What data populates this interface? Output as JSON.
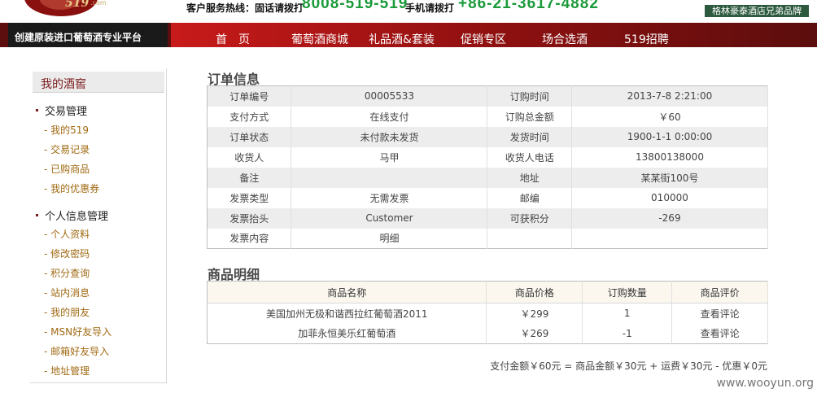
{
  "header": {
    "logo_text": "519",
    "logo_suffix": ".com",
    "service_hotline_label": "客户服务热线：固话请拨打",
    "service_hotline_number": "8008-519-519",
    "mobile_label": "手机请拨打",
    "mobile_number": "+86-21-3617-4882",
    "brand_text": "格林豪泰酒店兄弟品牌",
    "slogan": "创建原装进口葡萄酒专业平台"
  },
  "nav": {
    "items": [
      {
        "label": "首　页"
      },
      {
        "label": "葡萄酒商城"
      },
      {
        "label": "礼品酒&套装"
      },
      {
        "label": "促销专区"
      },
      {
        "label": "场合选酒"
      },
      {
        "label": "519招聘"
      }
    ]
  },
  "sidebar": {
    "title": "我的酒窖",
    "sections": [
      {
        "heading": "交易管理",
        "items": [
          "- 我的519",
          "- 交易记录",
          "- 已购商品",
          "- 我的优惠券"
        ]
      },
      {
        "heading": "个人信息管理",
        "items": [
          "- 个人资料",
          "- 修改密码",
          "- 积分查询",
          "- 站内消息",
          "- 我的朋友",
          "- MSN好友导入",
          "- 邮箱好友导入",
          "- 地址管理"
        ]
      }
    ]
  },
  "order_info": {
    "title": "订单信息",
    "rows": [
      {
        "l1": "订单编号",
        "v1": "00005533",
        "l2": "订购时间",
        "v2": "2013-7-8 2:21:00"
      },
      {
        "l1": "支付方式",
        "v1": "在线支付",
        "l2": "订购总金额",
        "v2": "￥60"
      },
      {
        "l1": "订单状态",
        "v1": "未付款未发货",
        "l2": "发货时间",
        "v2": "1900-1-1 0:00:00"
      },
      {
        "l1": "收货人",
        "v1": "马甲",
        "l2": "收货人电话",
        "v2": "13800138000"
      },
      {
        "l1": "备注",
        "v1": "",
        "l2": "地址",
        "v2": "某某街100号"
      },
      {
        "l1": "发票类型",
        "v1": "无需发票",
        "l2": "邮编",
        "v2": "010000"
      },
      {
        "l1": "发票抬头",
        "v1": "Customer",
        "l2": "可获积分",
        "v2": "-269"
      },
      {
        "l1": "发票内容",
        "v1": "明细",
        "l2": "",
        "v2": ""
      }
    ]
  },
  "products": {
    "title": "商品明细",
    "columns": [
      "商品名称",
      "商品价格",
      "订购数量",
      "商品评价"
    ],
    "rows": [
      {
        "name": "美国加州无极和谐西拉红葡萄酒2011",
        "price": "￥299",
        "qty": "1",
        "review": "查看评论"
      },
      {
        "name": "加菲永恒美乐红葡萄酒",
        "price": "￥269",
        "qty": "-1",
        "review": "查看评论"
      }
    ]
  },
  "payment_summary": "支付金额￥60元 = 商品金额￥30元 + 运费￥30元 - 优惠￥0元",
  "watermark": "www.wooyun.org",
  "colors": {
    "nav_red": "#c81a1a",
    "nav_dark": "#5c0d0d",
    "hotline_green": "#1b9a3a",
    "brand_green": "#2d5a3f",
    "price_red": "#a11818",
    "link_brown": "#a06a13"
  }
}
